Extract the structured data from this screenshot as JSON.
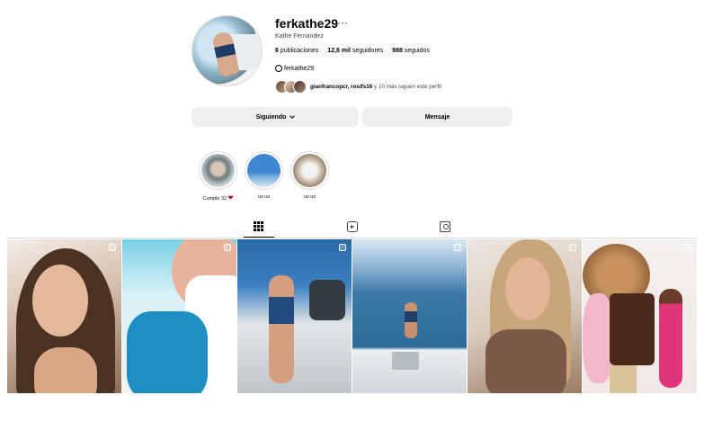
{
  "profile": {
    "username": "ferkathe29",
    "more_label": "···",
    "full_name": "Kathe Fernandez",
    "stats": {
      "posts_count": "6",
      "posts_label": "publicaciones",
      "followers_count": "12,6 mil",
      "followers_label": "seguidores",
      "following_count": "988",
      "following_label": "seguidos"
    },
    "threads_handle": "ferkathe29",
    "followed_by": {
      "names": "gianfrancopcr, rosifs16",
      "rest": "y 10 más siguen este perfil"
    }
  },
  "actions": {
    "follow_label": "Siguiendo",
    "message_label": "Mensaje"
  },
  "highlights": [
    {
      "label": "Cumple 32",
      "emoji": "❤"
    },
    {
      "label": "us us"
    },
    {
      "label": "us us"
    }
  ],
  "tabs": {
    "posts_icon": "grid-icon",
    "reels_icon": "reels-icon",
    "tagged_icon": "tagged-icon"
  },
  "colors": {
    "button_bg": "#efefef",
    "divider": "#dbdbdb"
  }
}
